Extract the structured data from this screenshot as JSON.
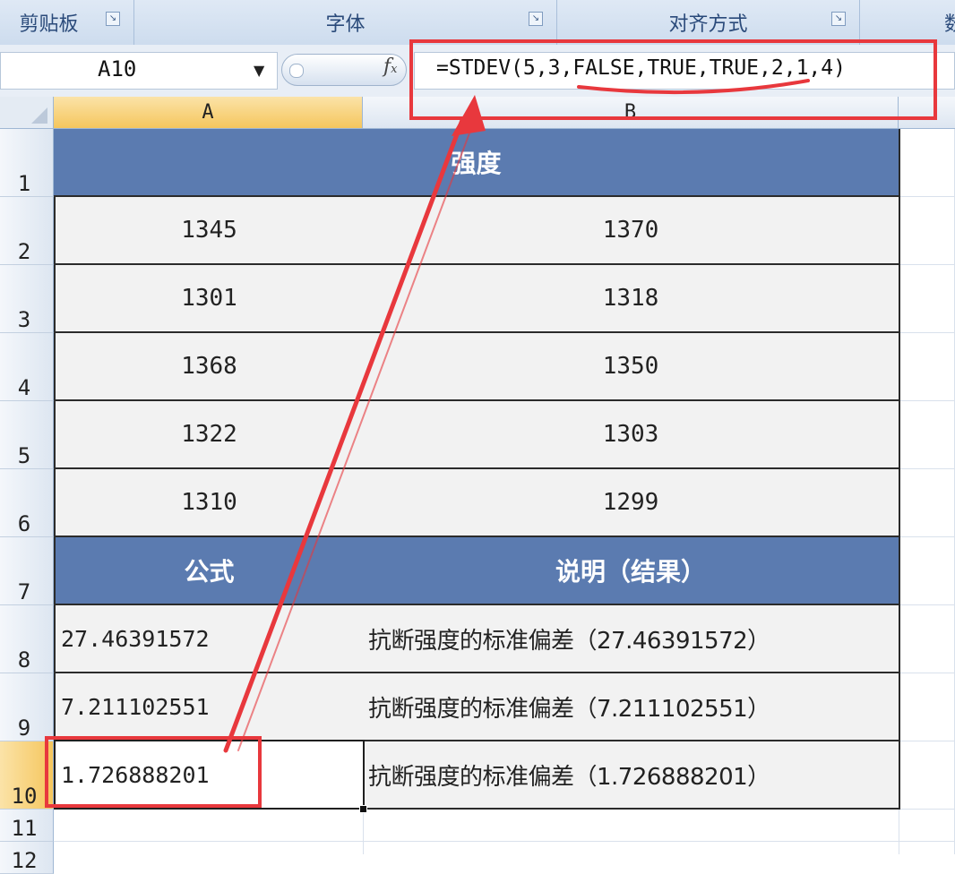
{
  "ribbon": {
    "groups": [
      "剪贴板",
      "字体",
      "对齐方式",
      "数"
    ]
  },
  "formula_bar": {
    "name_box": "A10",
    "fx_label": "f",
    "fx_sub": "x",
    "formula": "=STDEV(5,3,FALSE,TRUE,TRUE,2,1,4)"
  },
  "columns": [
    "A",
    "B"
  ],
  "rows": [
    "1",
    "2",
    "3",
    "4",
    "5",
    "6",
    "7",
    "8",
    "9",
    "10",
    "11",
    "12"
  ],
  "table": {
    "title": "强度",
    "values": [
      [
        "1345",
        "1370"
      ],
      [
        "1301",
        "1318"
      ],
      [
        "1368",
        "1350"
      ],
      [
        "1322",
        "1303"
      ],
      [
        "1310",
        "1299"
      ]
    ],
    "formula_header": "公式",
    "desc_header": "说明（结果）",
    "results": [
      [
        "27.46391572",
        "抗断强度的标准偏差（27.46391572）"
      ],
      [
        "7.211102551",
        "抗断强度的标准偏差（7.211102551）"
      ],
      [
        "1.726888201",
        "抗断强度的标准偏差（1.726888201）"
      ]
    ]
  },
  "colors": {
    "header_fill": "#5b7bb0",
    "cell_fill": "#f2f2f2",
    "annotation_red": "#e8383d",
    "selection_orange": "#f5c65d"
  }
}
